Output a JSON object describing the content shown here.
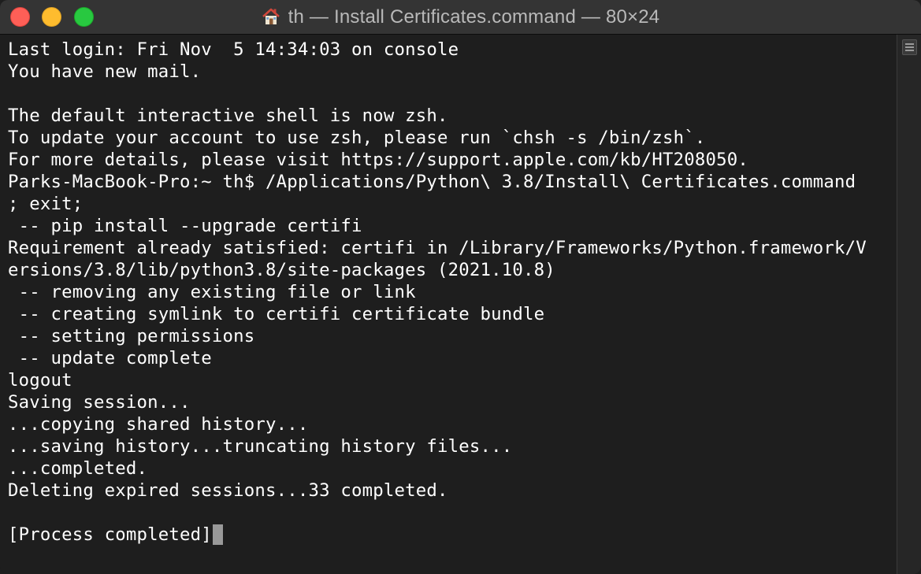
{
  "window": {
    "title": "th — Install Certificates.command — 80×24",
    "title_icon": "home-icon"
  },
  "traffic_lights": {
    "close": "#fe5f57",
    "minimize": "#febc2e",
    "zoom": "#28c840"
  },
  "terminal": {
    "background": "#1e1e1e",
    "foreground": "#ffffff",
    "lines": [
      "Last login: Fri Nov  5 14:34:03 on console",
      "You have new mail.",
      "",
      "The default interactive shell is now zsh.",
      "To update your account to use zsh, please run `chsh -s /bin/zsh`.",
      "For more details, please visit https://support.apple.com/kb/HT208050.",
      "Parks-MacBook-Pro:~ th$ /Applications/Python\\ 3.8/Install\\ Certificates.command",
      "; exit;",
      " -- pip install --upgrade certifi",
      "Requirement already satisfied: certifi in /Library/Frameworks/Python.framework/V",
      "ersions/3.8/lib/python3.8/site-packages (2021.10.8)",
      " -- removing any existing file or link",
      " -- creating symlink to certifi certificate bundle",
      " -- setting permissions",
      " -- update complete",
      "logout",
      "Saving session...",
      "...copying shared history...",
      "...saving history...truncating history files...",
      "...completed.",
      "Deleting expired sessions...33 completed.",
      "",
      "[Process completed]"
    ]
  },
  "scrollbar": {
    "split_icon": "split-pane-icon"
  }
}
